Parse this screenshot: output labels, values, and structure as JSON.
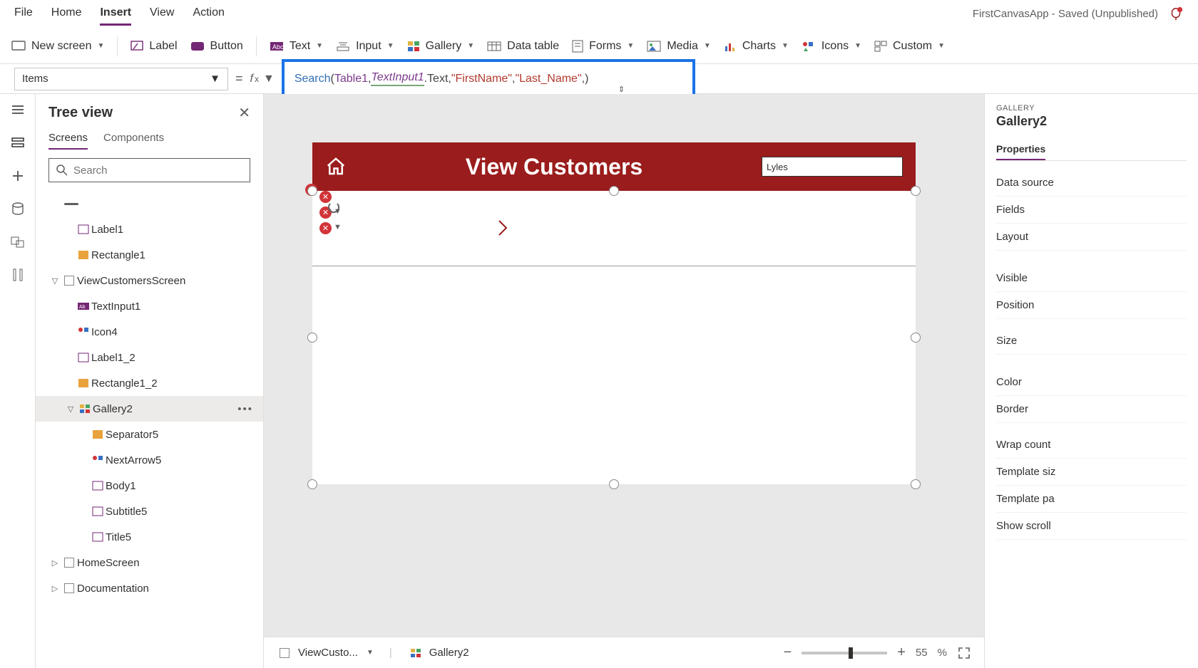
{
  "menu": {
    "tabs": [
      "File",
      "Home",
      "Insert",
      "View",
      "Action"
    ],
    "active": "Insert",
    "title": "FirstCanvasApp - Saved (Unpublished)"
  },
  "ribbon": {
    "new_screen": "New screen",
    "label": "Label",
    "button": "Button",
    "text": "Text",
    "input": "Input",
    "gallery": "Gallery",
    "data_table": "Data table",
    "forms": "Forms",
    "media": "Media",
    "charts": "Charts",
    "icons": "Icons",
    "custom": "Custom"
  },
  "formula": {
    "property": "Items",
    "tokens": {
      "fn": "Search",
      "open": "(",
      "t1": "Table1",
      "c1": ", ",
      "t2": "TextInput1",
      "t2b": ".Text",
      "c2": ", ",
      "s1": "\"FirstName\"",
      "c3": ", ",
      "s2": "\"Last_Name\"",
      "c4": ", ",
      "close": ")"
    }
  },
  "tree": {
    "title": "Tree view",
    "tabs": {
      "screens": "Screens",
      "components": "Components"
    },
    "search_placeholder": "Search",
    "nodes": {
      "label1": "Label1",
      "rectangle1": "Rectangle1",
      "viewcustomers": "ViewCustomersScreen",
      "textinput1": "TextInput1",
      "icon4": "Icon4",
      "label1_2": "Label1_2",
      "rectangle1_2": "Rectangle1_2",
      "gallery2": "Gallery2",
      "separator5": "Separator5",
      "nextarrow5": "NextArrow5",
      "body1": "Body1",
      "subtitle5": "Subtitle5",
      "title5": "Title5",
      "homescreen": "HomeScreen",
      "documentation": "Documentation"
    }
  },
  "canvas": {
    "header_title": "View Customers",
    "search_value": "Lyles"
  },
  "crumbs": {
    "a": "ViewCusto...",
    "b": "Gallery2"
  },
  "zoom": {
    "value": "55",
    "pct": "%"
  },
  "props": {
    "type_label": "GALLERY",
    "name": "Gallery2",
    "tab_props": "Properties",
    "rows": {
      "data_source": "Data source",
      "fields": "Fields",
      "layout": "Layout",
      "visible": "Visible",
      "position": "Position",
      "size": "Size",
      "color": "Color",
      "border": "Border",
      "wrap": "Wrap count",
      "tsize": "Template siz",
      "tpad": "Template pa",
      "scroll": "Show scroll"
    }
  }
}
